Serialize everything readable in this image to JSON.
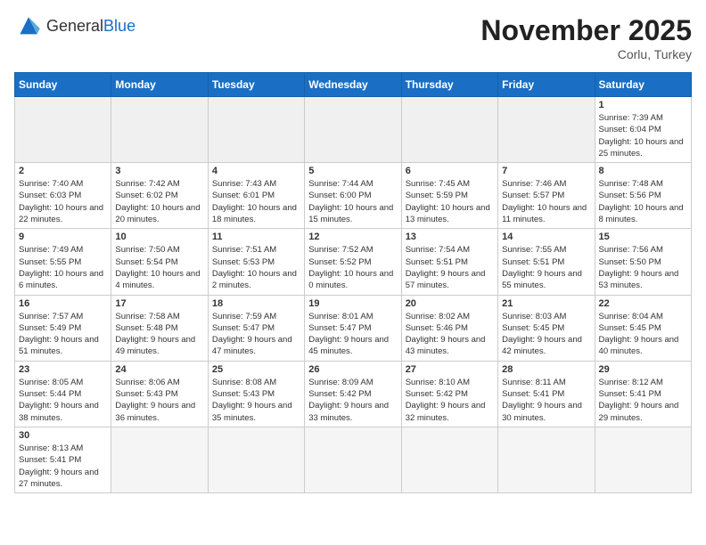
{
  "header": {
    "logo_general": "General",
    "logo_blue": "Blue",
    "month": "November 2025",
    "location": "Corlu, Turkey"
  },
  "weekdays": [
    "Sunday",
    "Monday",
    "Tuesday",
    "Wednesday",
    "Thursday",
    "Friday",
    "Saturday"
  ],
  "weeks": [
    [
      {
        "day": "",
        "info": ""
      },
      {
        "day": "",
        "info": ""
      },
      {
        "day": "",
        "info": ""
      },
      {
        "day": "",
        "info": ""
      },
      {
        "day": "",
        "info": ""
      },
      {
        "day": "",
        "info": ""
      },
      {
        "day": "1",
        "info": "Sunrise: 7:39 AM\nSunset: 6:04 PM\nDaylight: 10 hours and 25 minutes."
      }
    ],
    [
      {
        "day": "2",
        "info": "Sunrise: 7:40 AM\nSunset: 6:03 PM\nDaylight: 10 hours and 22 minutes."
      },
      {
        "day": "3",
        "info": "Sunrise: 7:42 AM\nSunset: 6:02 PM\nDaylight: 10 hours and 20 minutes."
      },
      {
        "day": "4",
        "info": "Sunrise: 7:43 AM\nSunset: 6:01 PM\nDaylight: 10 hours and 18 minutes."
      },
      {
        "day": "5",
        "info": "Sunrise: 7:44 AM\nSunset: 6:00 PM\nDaylight: 10 hours and 15 minutes."
      },
      {
        "day": "6",
        "info": "Sunrise: 7:45 AM\nSunset: 5:59 PM\nDaylight: 10 hours and 13 minutes."
      },
      {
        "day": "7",
        "info": "Sunrise: 7:46 AM\nSunset: 5:57 PM\nDaylight: 10 hours and 11 minutes."
      },
      {
        "day": "8",
        "info": "Sunrise: 7:48 AM\nSunset: 5:56 PM\nDaylight: 10 hours and 8 minutes."
      }
    ],
    [
      {
        "day": "9",
        "info": "Sunrise: 7:49 AM\nSunset: 5:55 PM\nDaylight: 10 hours and 6 minutes."
      },
      {
        "day": "10",
        "info": "Sunrise: 7:50 AM\nSunset: 5:54 PM\nDaylight: 10 hours and 4 minutes."
      },
      {
        "day": "11",
        "info": "Sunrise: 7:51 AM\nSunset: 5:53 PM\nDaylight: 10 hours and 2 minutes."
      },
      {
        "day": "12",
        "info": "Sunrise: 7:52 AM\nSunset: 5:52 PM\nDaylight: 10 hours and 0 minutes."
      },
      {
        "day": "13",
        "info": "Sunrise: 7:54 AM\nSunset: 5:51 PM\nDaylight: 9 hours and 57 minutes."
      },
      {
        "day": "14",
        "info": "Sunrise: 7:55 AM\nSunset: 5:51 PM\nDaylight: 9 hours and 55 minutes."
      },
      {
        "day": "15",
        "info": "Sunrise: 7:56 AM\nSunset: 5:50 PM\nDaylight: 9 hours and 53 minutes."
      }
    ],
    [
      {
        "day": "16",
        "info": "Sunrise: 7:57 AM\nSunset: 5:49 PM\nDaylight: 9 hours and 51 minutes."
      },
      {
        "day": "17",
        "info": "Sunrise: 7:58 AM\nSunset: 5:48 PM\nDaylight: 9 hours and 49 minutes."
      },
      {
        "day": "18",
        "info": "Sunrise: 7:59 AM\nSunset: 5:47 PM\nDaylight: 9 hours and 47 minutes."
      },
      {
        "day": "19",
        "info": "Sunrise: 8:01 AM\nSunset: 5:47 PM\nDaylight: 9 hours and 45 minutes."
      },
      {
        "day": "20",
        "info": "Sunrise: 8:02 AM\nSunset: 5:46 PM\nDaylight: 9 hours and 43 minutes."
      },
      {
        "day": "21",
        "info": "Sunrise: 8:03 AM\nSunset: 5:45 PM\nDaylight: 9 hours and 42 minutes."
      },
      {
        "day": "22",
        "info": "Sunrise: 8:04 AM\nSunset: 5:45 PM\nDaylight: 9 hours and 40 minutes."
      }
    ],
    [
      {
        "day": "23",
        "info": "Sunrise: 8:05 AM\nSunset: 5:44 PM\nDaylight: 9 hours and 38 minutes."
      },
      {
        "day": "24",
        "info": "Sunrise: 8:06 AM\nSunset: 5:43 PM\nDaylight: 9 hours and 36 minutes."
      },
      {
        "day": "25",
        "info": "Sunrise: 8:08 AM\nSunset: 5:43 PM\nDaylight: 9 hours and 35 minutes."
      },
      {
        "day": "26",
        "info": "Sunrise: 8:09 AM\nSunset: 5:42 PM\nDaylight: 9 hours and 33 minutes."
      },
      {
        "day": "27",
        "info": "Sunrise: 8:10 AM\nSunset: 5:42 PM\nDaylight: 9 hours and 32 minutes."
      },
      {
        "day": "28",
        "info": "Sunrise: 8:11 AM\nSunset: 5:41 PM\nDaylight: 9 hours and 30 minutes."
      },
      {
        "day": "29",
        "info": "Sunrise: 8:12 AM\nSunset: 5:41 PM\nDaylight: 9 hours and 29 minutes."
      }
    ],
    [
      {
        "day": "30",
        "info": "Sunrise: 8:13 AM\nSunset: 5:41 PM\nDaylight: 9 hours and 27 minutes."
      },
      {
        "day": "",
        "info": ""
      },
      {
        "day": "",
        "info": ""
      },
      {
        "day": "",
        "info": ""
      },
      {
        "day": "",
        "info": ""
      },
      {
        "day": "",
        "info": ""
      },
      {
        "day": "",
        "info": ""
      }
    ]
  ]
}
